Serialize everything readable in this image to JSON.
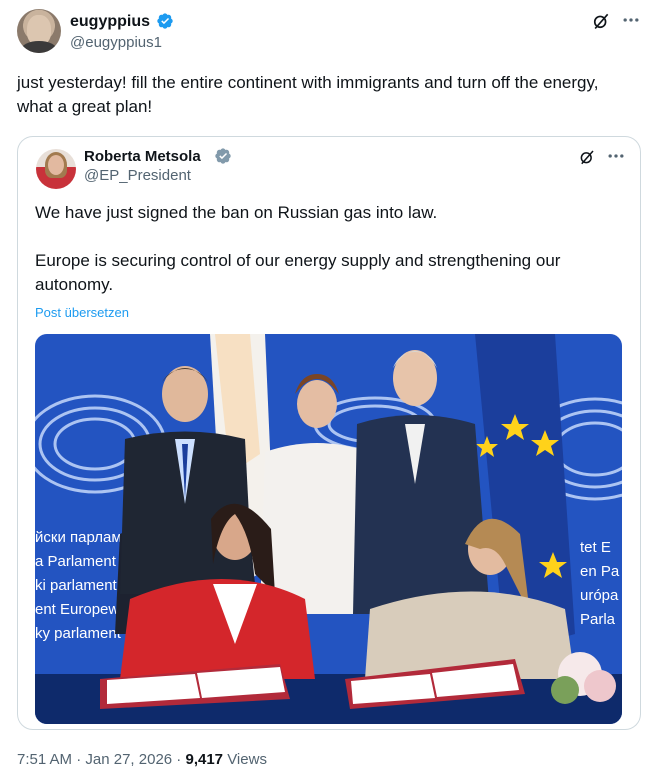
{
  "post": {
    "author": {
      "name": "eugyppius",
      "handle": "@eugyppius1"
    },
    "text": "just yesterday! fill the entire continent with immigrants and turn off the energy, what a great plan!",
    "footer": {
      "time": "7:51 AM",
      "sep1": " · ",
      "date": "Jan 27, 2026",
      "sep2": " · ",
      "views_count": "9,417",
      "views_label": " Views"
    }
  },
  "quote": {
    "author": {
      "name": "Roberta Metsola",
      "handle": "@EP_President"
    },
    "text": "We have just signed the ban on Russian gas into law.\n\nEurope is securing control of our energy supply and strengthening our autonomy.",
    "translate_label": "Post übersetzen",
    "photo_sign_lines": [
      "йски парлам",
      "a Parlament E",
      "ki parlament F",
      "ent Europew",
      "ky parlament"
    ],
    "photo_sign_lines_right": [
      "tet E",
      "en Pa",
      "urópa",
      "Parla"
    ]
  },
  "colors": {
    "verified": "#1d9bf0",
    "link": "#1d9bf0",
    "muted": "#536471",
    "eu_blue": "#1f4fb8"
  },
  "icons": [
    "verified-badge-icon",
    "grok-icon",
    "more-icon"
  ]
}
